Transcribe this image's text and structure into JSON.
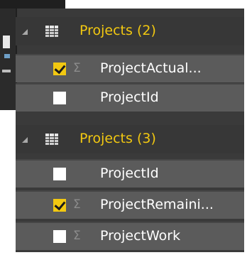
{
  "fields_panel": {
    "groups": [
      {
        "label": "Projects (2)",
        "fields": [
          {
            "label": "ProjectActual...",
            "checked": true,
            "aggregate_icon": "sigma-icon"
          },
          {
            "label": "ProjectId",
            "checked": false,
            "aggregate_icon": ""
          }
        ]
      },
      {
        "label": "Projects (3)",
        "fields": [
          {
            "label": "ProjectId",
            "checked": false,
            "aggregate_icon": ""
          },
          {
            "label": "ProjectRemaini...",
            "checked": true,
            "aggregate_icon": "sigma-icon"
          },
          {
            "label": "ProjectWork",
            "checked": false,
            "aggregate_icon": "sigma-icon"
          }
        ]
      }
    ],
    "sigma_glyph": "Σ"
  },
  "colors": {
    "accent": "#f2c811",
    "panel_bg": "#3a3a3a",
    "row_bg": "#5b5b5b"
  }
}
